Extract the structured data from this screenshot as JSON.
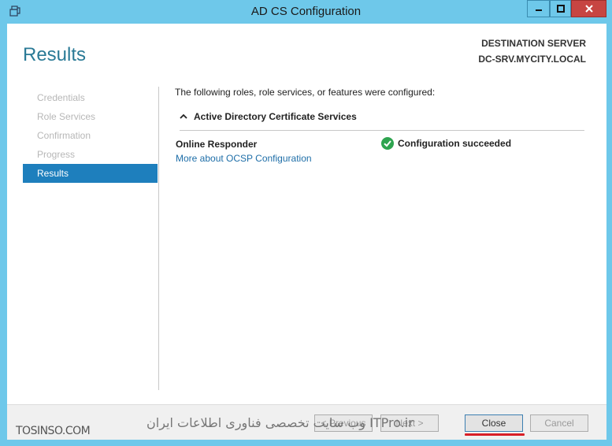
{
  "window": {
    "title": "AD CS Configuration"
  },
  "header": {
    "page_title": "Results",
    "destination_label": "DESTINATION SERVER",
    "destination_server": "DC-SRV.MYCITY.LOCAL"
  },
  "nav": {
    "items": [
      {
        "label": "Credentials",
        "state": "disabled"
      },
      {
        "label": "Role Services",
        "state": "disabled"
      },
      {
        "label": "Confirmation",
        "state": "disabled"
      },
      {
        "label": "Progress",
        "state": "disabled"
      },
      {
        "label": "Results",
        "state": "active"
      }
    ]
  },
  "content": {
    "intro": "The following roles, role services, or features were configured:",
    "section_title": "Active Directory Certificate Services",
    "role_name": "Online Responder",
    "role_status": "Configuration succeeded",
    "role_link": "More about OCSP Configuration"
  },
  "footer": {
    "previous_label": "< Previous",
    "next_label": "Next >",
    "close_label": "Close",
    "cancel_label": "Cancel",
    "watermark_left": "TOSINSO.COM",
    "watermark_center": "وب سایت تخصصی فناوری اطلاعات ایران  ITPro.ir"
  },
  "colors": {
    "title_bar": "#6ec8ea",
    "accent": "#1e7fbd",
    "close_button": "#c74542",
    "success": "#2ea44f"
  }
}
